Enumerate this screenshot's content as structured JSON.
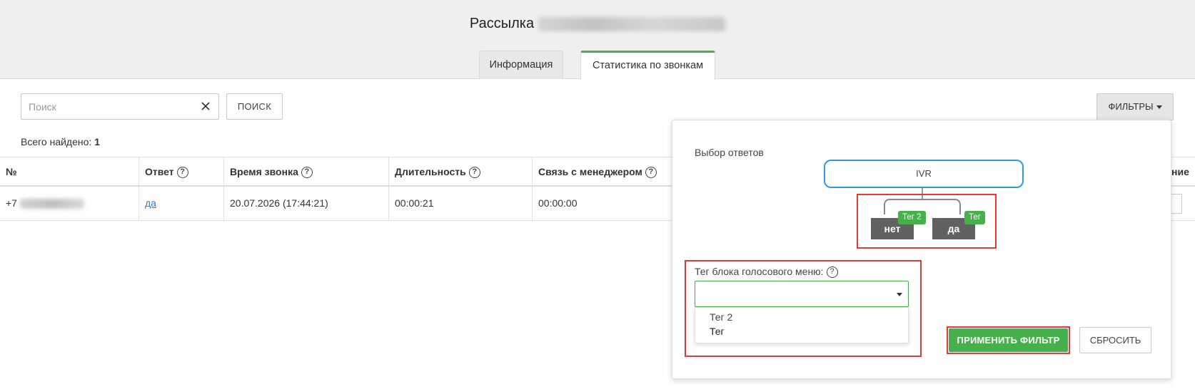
{
  "header": {
    "title": "Рассылка",
    "tabs": [
      {
        "label": "Информация"
      },
      {
        "label": "Статистика по звонкам"
      }
    ]
  },
  "toolbar": {
    "search_placeholder": "Поиск",
    "search_value": "",
    "search_button": "ПОИСК",
    "filters_button": "ФИЛЬТРЫ"
  },
  "summary": {
    "label": "Всего найдено:",
    "count": "1"
  },
  "table": {
    "columns": [
      {
        "label": "№"
      },
      {
        "label": "Ответ"
      },
      {
        "label": "Время звонка"
      },
      {
        "label": "Длительность"
      },
      {
        "label": "Связь с менеджером"
      },
      {
        "label": "ние"
      }
    ],
    "rows": [
      {
        "phone_prefix": "+7",
        "answer": "да",
        "time": "20.07.2026 (17:44:21)",
        "duration": "00:00:21",
        "manager": "00:00:00"
      }
    ]
  },
  "filter_panel": {
    "section_label": "Выбор ответов",
    "root_node": "IVR",
    "nodes": [
      {
        "label": "нет",
        "tag": "Тег 2"
      },
      {
        "label": "да",
        "tag": "Тег"
      }
    ],
    "tag_label": "Тег блока голосового меню:",
    "tag_select_value": "",
    "tag_options": [
      "Тег 2",
      "Тег"
    ],
    "apply_button": "ПРИМЕНИТЬ ФИЛЬТР",
    "reset_button": "СБРОСИТЬ"
  },
  "colors": {
    "accent_green": "#46b04a",
    "ivr_border": "#2e9be0",
    "highlight_red": "#e53935",
    "node_gray": "#616161",
    "link_blue": "#2a7bd6"
  }
}
